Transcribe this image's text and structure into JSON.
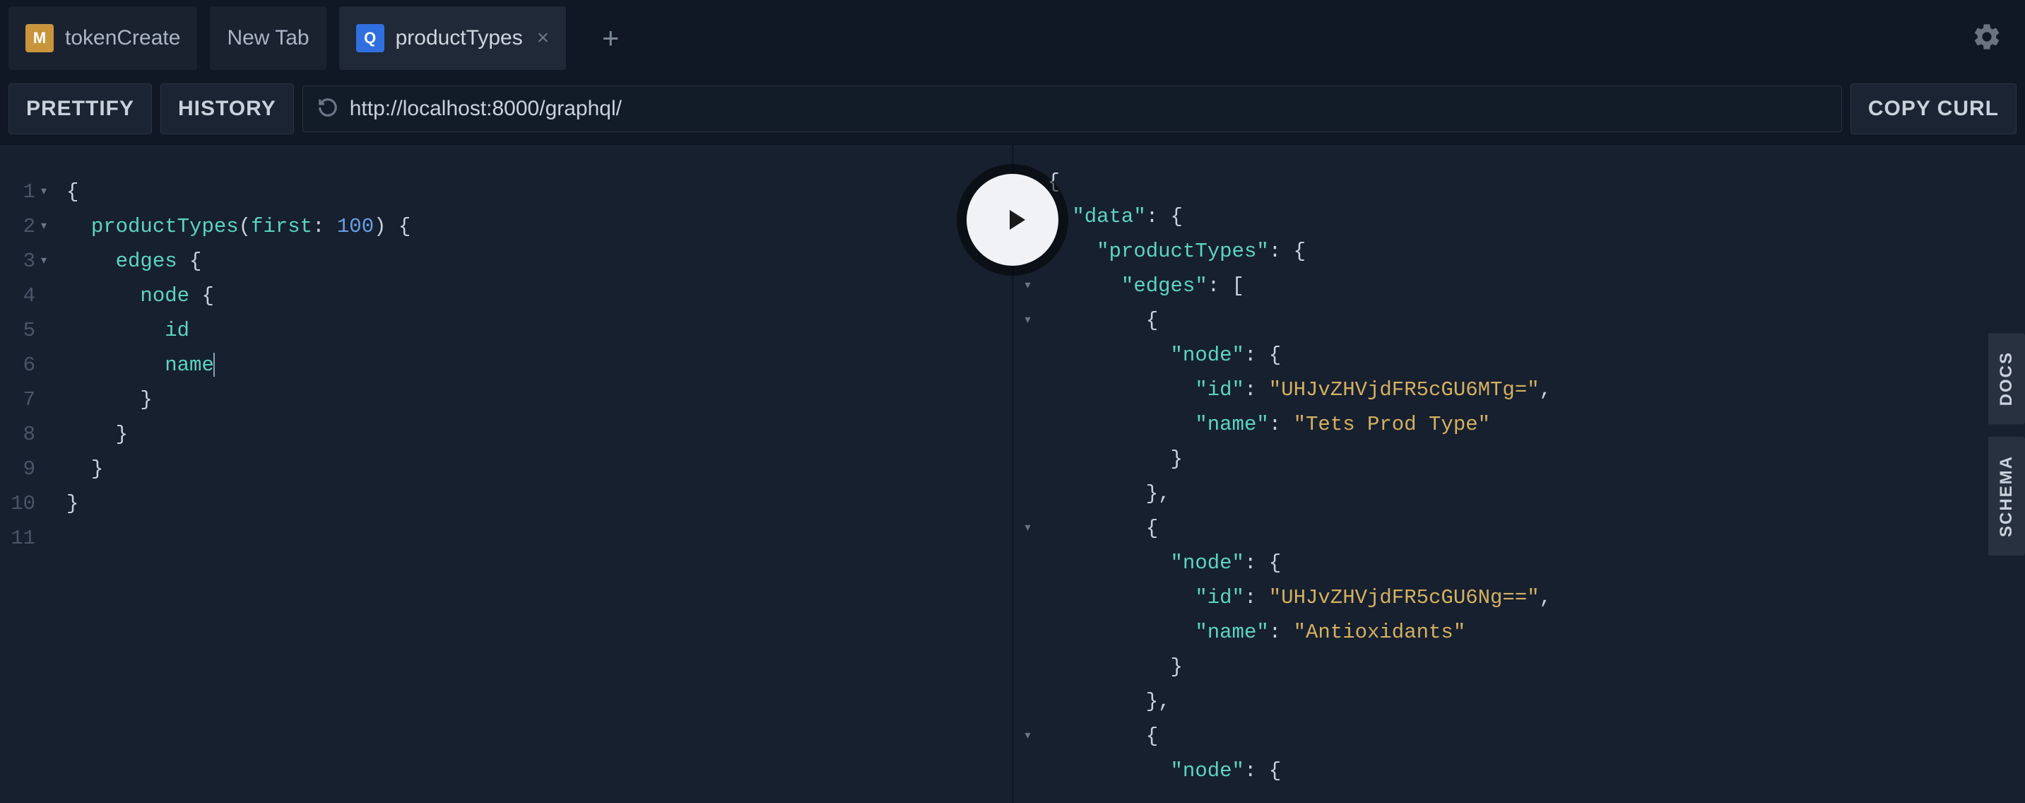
{
  "tabs": [
    {
      "badge": "M",
      "label": "tokenCreate"
    },
    {
      "badge": "",
      "label": "New Tab"
    },
    {
      "badge": "Q",
      "label": "productTypes"
    }
  ],
  "toolbar": {
    "prettify": "PRETTIFY",
    "history": "HISTORY",
    "url": "http://localhost:8000/graphql/",
    "copy_curl": "COPY CURL"
  },
  "sideTabs": {
    "docs": "DOCS",
    "schema": "SCHEMA"
  },
  "query": {
    "lines": [
      "1",
      "2",
      "3",
      "4",
      "5",
      "6",
      "7",
      "8",
      "9",
      "10",
      "11"
    ],
    "field_productTypes": "productTypes",
    "arg_first": "first",
    "val_first": "100",
    "field_edges": "edges",
    "field_node": "node",
    "field_id": "id",
    "field_name": "name"
  },
  "result": {
    "k_data": "\"data\"",
    "k_productTypes": "\"productTypes\"",
    "k_edges": "\"edges\"",
    "k_node": "\"node\"",
    "k_id": "\"id\"",
    "k_name": "\"name\"",
    "v_id1": "\"UHJvZHVjdFR5cGU6MTg=\"",
    "v_name1": "\"Tets Prod Type\"",
    "v_id2": "\"UHJvZHVjdFR5cGU6Ng==\"",
    "v_name2": "\"Antioxidants\""
  }
}
